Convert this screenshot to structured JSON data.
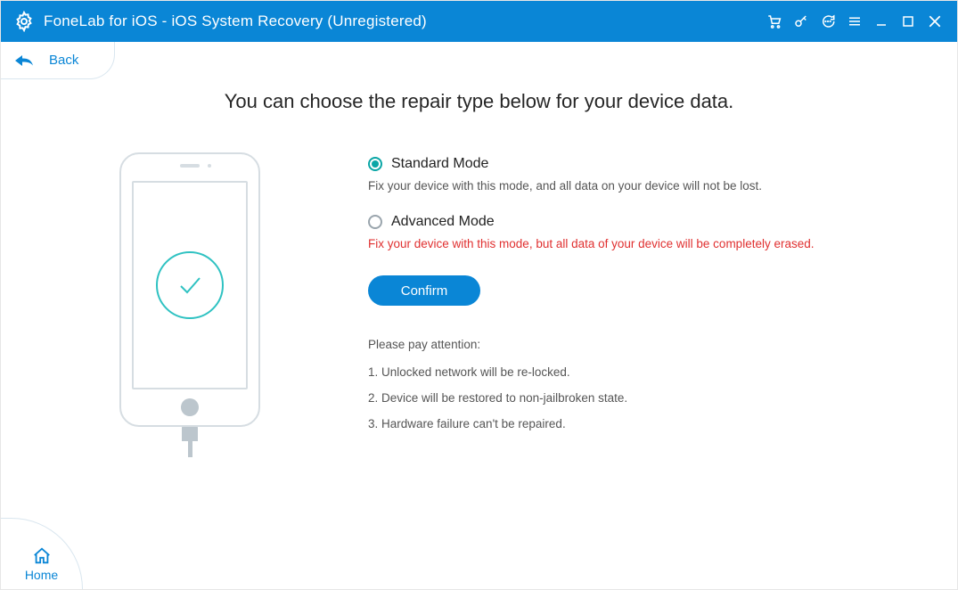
{
  "titlebar": {
    "title": "FoneLab for iOS - iOS System Recovery (Unregistered)"
  },
  "back": {
    "label": "Back"
  },
  "heading": "You can choose the repair type below for your device data.",
  "options": {
    "standard": {
      "label": "Standard Mode",
      "desc": "Fix your device with this mode, and all data on your device will not be lost.",
      "selected": true
    },
    "advanced": {
      "label": "Advanced Mode",
      "desc": "Fix your device with this mode, but all data of your device will be completely erased.",
      "selected": false
    }
  },
  "confirm": "Confirm",
  "notes": {
    "head": "Please pay attention:",
    "items": [
      "1. Unlocked network will be re-locked.",
      "2. Device will be restored to non-jailbroken state.",
      "3. Hardware failure can't be repaired."
    ]
  },
  "homeButton": "Home"
}
